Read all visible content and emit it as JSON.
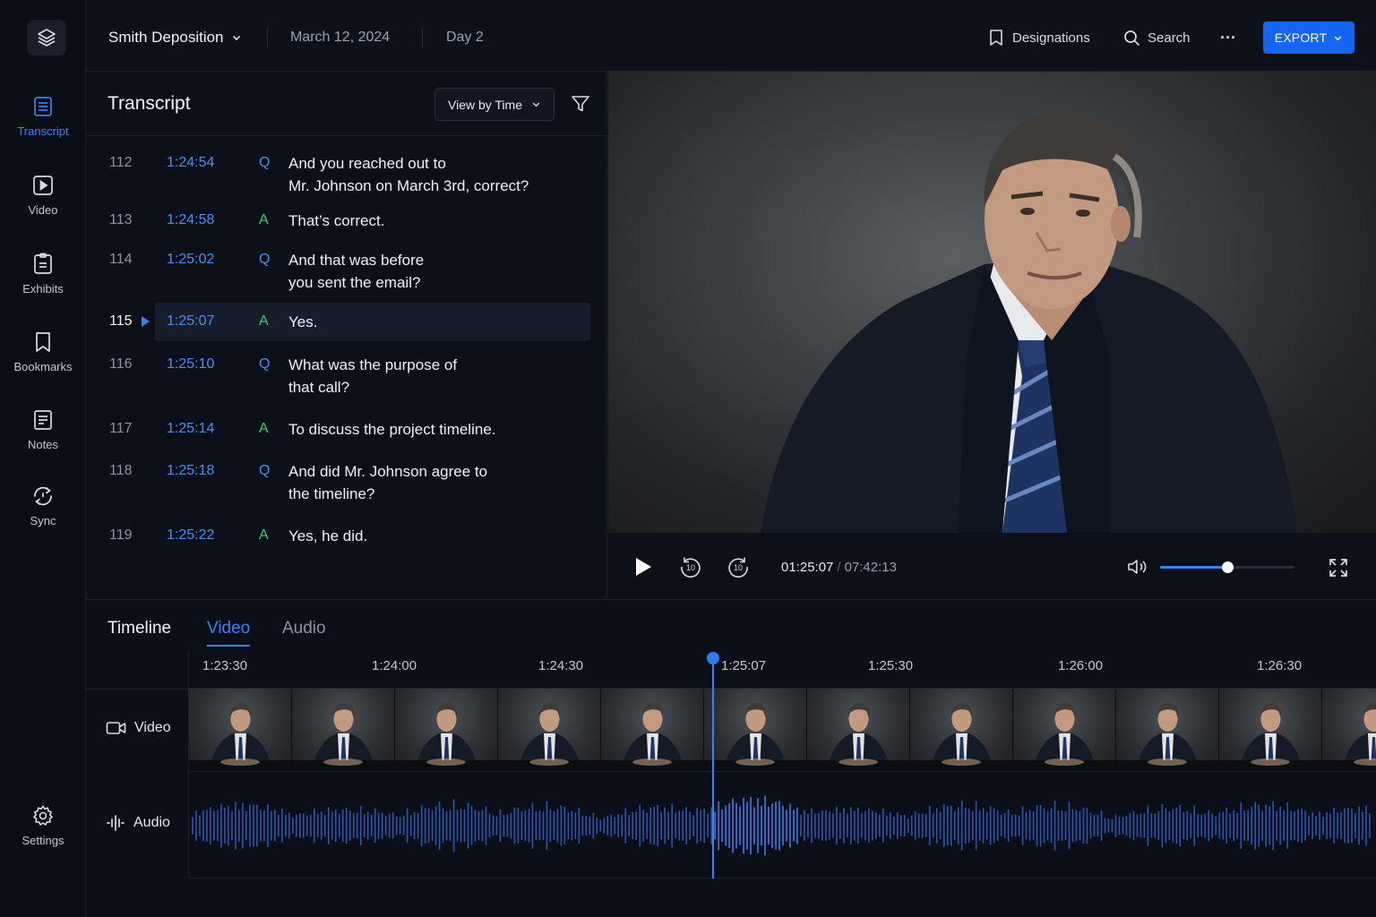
{
  "topbar": {
    "case_name": "Smith Deposition",
    "date": "March 12, 2024",
    "day": "Day 2",
    "designations_label": "Designations",
    "search_label": "Search",
    "more_label": "···",
    "export_label": "EXPORT"
  },
  "sidebar": {
    "items": [
      {
        "label": "Transcript",
        "icon": "transcript-icon"
      },
      {
        "label": "Video",
        "icon": "video-icon"
      },
      {
        "label": "Exhibits",
        "icon": "exhibits-icon"
      },
      {
        "label": "Bookmarks",
        "icon": "bookmark-icon"
      },
      {
        "label": "Notes",
        "icon": "notes-icon"
      },
      {
        "label": "Sync",
        "icon": "sync-icon"
      }
    ],
    "settings_label": "Settings"
  },
  "transcript": {
    "title": "Transcript",
    "view_label": "View by Time",
    "rows": [
      {
        "num": "112",
        "time": "1:24:54",
        "speaker": "Q",
        "line1": "And you reached out to",
        "line2": "Mr. Johnson on March 3rd, correct?"
      },
      {
        "num": "113",
        "time": "1:24:58",
        "speaker": "A",
        "line1": "That’s correct.",
        "line2": ""
      },
      {
        "num": "114",
        "time": "1:25:02",
        "speaker": "Q",
        "line1": "And that was before",
        "line2": "you sent the email?"
      },
      {
        "num": "115",
        "time": "1:25:07",
        "speaker": "A",
        "line1": "Yes.",
        "line2": ""
      },
      {
        "num": "116",
        "time": "1:25:10",
        "speaker": "Q",
        "line1": "What was the purpose of",
        "line2": "that call?"
      },
      {
        "num": "117",
        "time": "1:25:14",
        "speaker": "A",
        "line1": "To discuss the project timeline.",
        "line2": ""
      },
      {
        "num": "118",
        "time": "1:25:18",
        "speaker": "Q",
        "line1": "And did Mr. Johnson agree to",
        "line2": "the timeline?"
      },
      {
        "num": "119",
        "time": "1:25:22",
        "speaker": "A",
        "line1": "Yes, he did.",
        "line2": ""
      }
    ],
    "current_row": "115"
  },
  "player": {
    "current_time": "01:25:07",
    "separator": "/",
    "total_time": "07:42:13",
    "volume_fraction": 0.5
  },
  "timeline": {
    "title": "Timeline",
    "tabs": [
      "Video",
      "Audio"
    ],
    "active_tab": "Video",
    "ticks": [
      "1:23:30",
      "1:24:00",
      "1:24:30",
      "1:25:07",
      "1:25:30",
      "1:26:00",
      "1:26:30"
    ],
    "video_track_label": "Video",
    "audio_track_label": "Audio",
    "playhead_time": "1:25:07"
  },
  "colors": {
    "accent": "#3b82f6",
    "answer": "#3ecf7a",
    "background": "#0b0f17"
  }
}
